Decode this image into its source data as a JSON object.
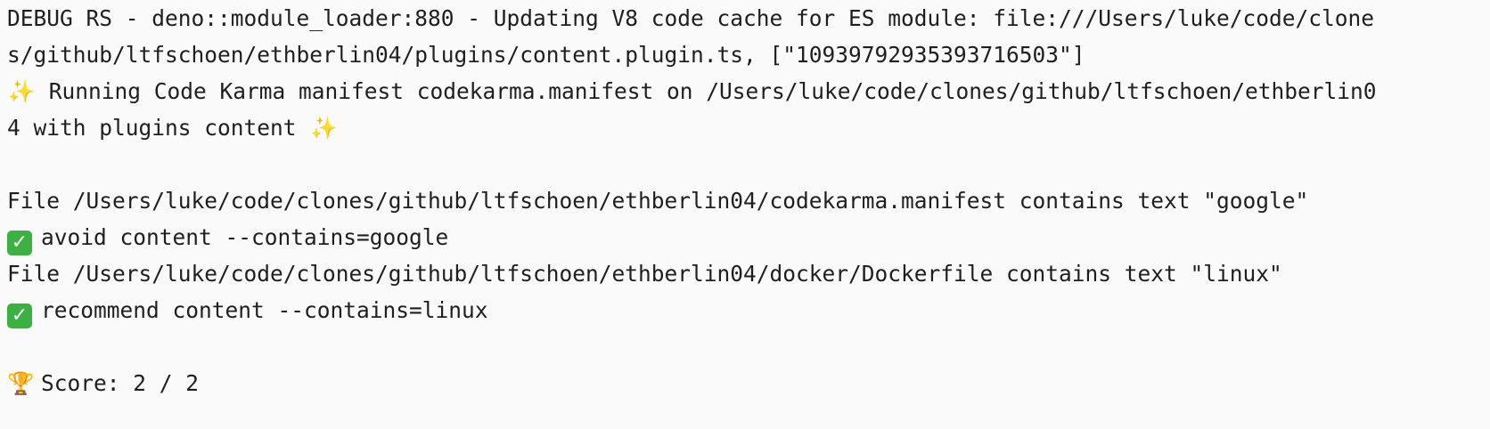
{
  "terminal": {
    "line1": "DEBUG RS - deno::module_loader:880 - Updating V8 code cache for ES module: file:///Users/luke/code/clone",
    "line2": "s/github/ltfschoen/ethberlin04/plugins/content.plugin.ts, [\"10939792935393716503\"]",
    "line3_text": " Running Code Karma manifest codekarma.manifest on /Users/luke/code/clones/github/ltfschoen/ethberlin0",
    "line4_text": "4 with plugins content ",
    "line5": "",
    "line6": "File /Users/luke/code/clones/github/ltfschoen/ethberlin04/codekarma.manifest contains text \"google\"",
    "line7_text": "avoid content --contains=google",
    "line8": "File /Users/luke/code/clones/github/ltfschoen/ethberlin04/docker/Dockerfile contains text \"linux\"",
    "line9_text": "recommend content --contains=linux",
    "line10": "",
    "line11_text": "Score: 2 / 2"
  },
  "icons": {
    "sparkle": "✨",
    "check": "✓",
    "trophy": "🏆"
  },
  "colors": {
    "background": "#fafafa",
    "text": "#1f1f1f",
    "check_bg": "#3cb043"
  }
}
